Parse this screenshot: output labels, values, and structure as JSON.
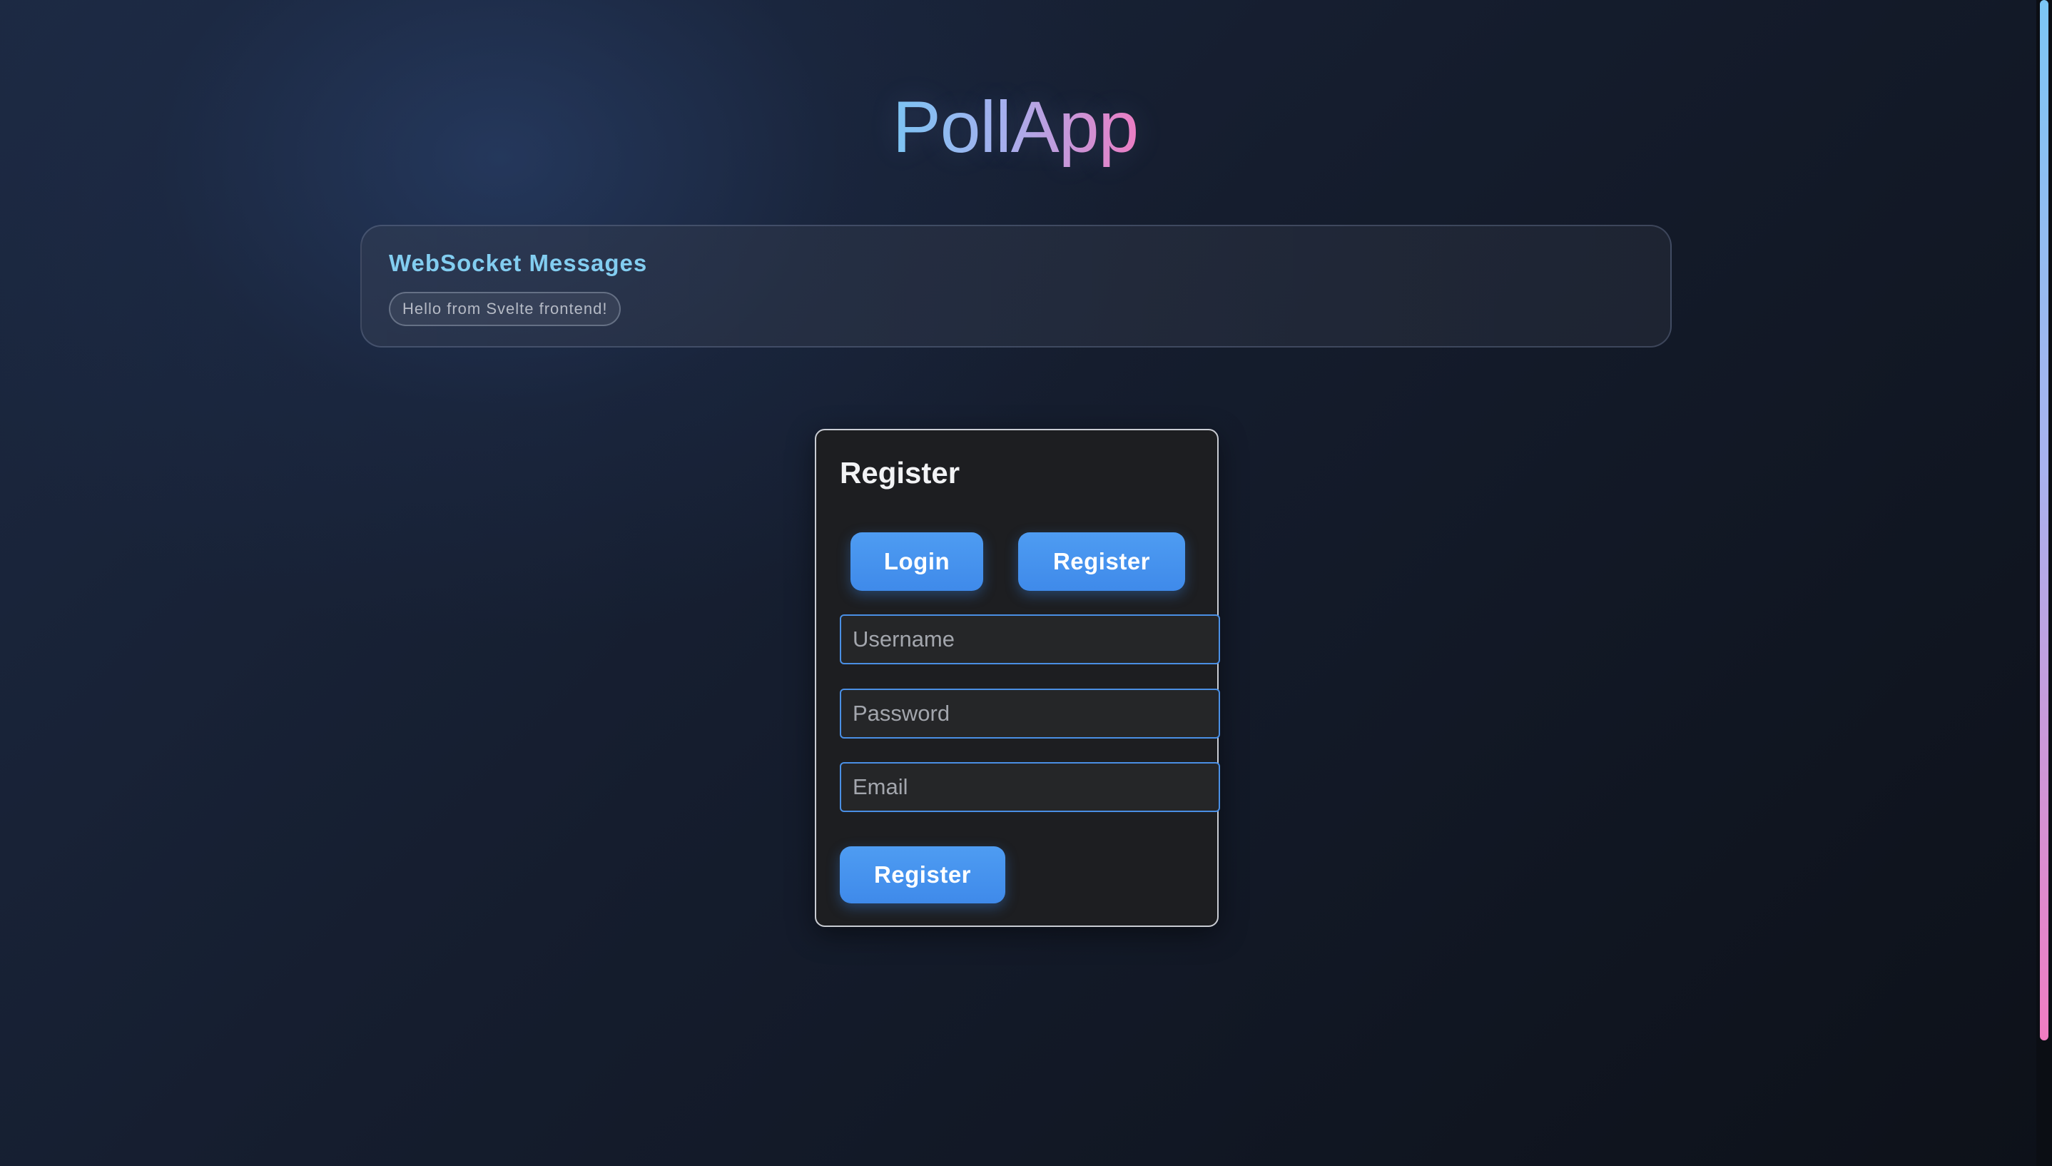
{
  "app": {
    "title": "PollApp"
  },
  "websocket": {
    "heading": "WebSocket Messages",
    "messages": [
      "Hello from Svelte frontend!"
    ]
  },
  "auth": {
    "title": "Register",
    "mode": "register",
    "toggle": {
      "login_label": "Login",
      "register_label": "Register"
    },
    "fields": {
      "username": {
        "placeholder": "Username",
        "value": ""
      },
      "password": {
        "placeholder": "Password",
        "value": ""
      },
      "email": {
        "placeholder": "Email",
        "value": ""
      }
    },
    "submit_label": "Register"
  },
  "theme": {
    "accent": "#4a8fe4",
    "title_gradient": [
      "#7cc6f4",
      "#a8b2ee",
      "#f07cc2"
    ],
    "heading_color": "#82cdf0",
    "card_background": "#1d1e21"
  }
}
